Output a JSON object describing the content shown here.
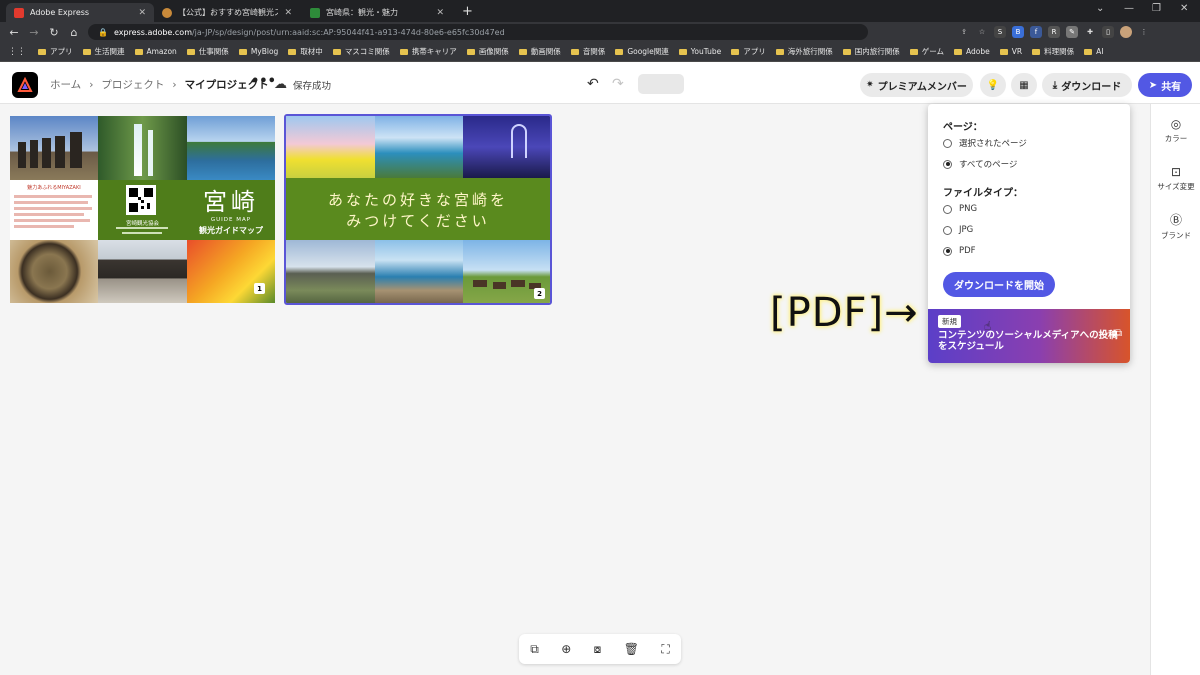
{
  "browser": {
    "tabs": [
      {
        "title": "Adobe Express",
        "active": true
      },
      {
        "title": "【公式】おすすめ宮崎観光スポット／...",
        "active": false
      },
      {
        "title": "宮崎県：観光・魅力",
        "active": false
      }
    ],
    "url_host": "express.adobe.com",
    "url_path": "/ja-JP/sp/design/post/urn:aaid:sc:AP:95044f41-a913-474d-80e6-e65fc30d47ed",
    "bookmarks": [
      "アプリ",
      "生活関連",
      "Amazon",
      "仕事関係",
      "MyBlog",
      "取材中",
      "マスコミ関係",
      "携帯キャリア",
      "画像関係",
      "動画関係",
      "音関係",
      "Google関連",
      "YouTube",
      "アプリ",
      "海外旅行関係",
      "国内旅行関係",
      "ゲーム",
      "Adobe",
      "VR",
      "料理関係",
      "AI"
    ]
  },
  "header": {
    "breadcrumb": [
      "ホーム",
      "プロジェクト",
      "マイプロジェクト"
    ],
    "more": "•••",
    "saved_status": "保存成功",
    "premium_label": "プレミアムメンバー",
    "download_label": "ダウンロード",
    "share_label": "共有"
  },
  "rail": [
    {
      "label": "カラー",
      "icon": "palette-icon"
    },
    {
      "label": "サイズ変更",
      "icon": "resize-icon"
    },
    {
      "label": "ブランド",
      "icon": "brand-icon"
    }
  ],
  "download_panel": {
    "pages_heading": "ページ：",
    "page_options": [
      {
        "label": "選択されたページ",
        "selected": false
      },
      {
        "label": "すべてのページ",
        "selected": true
      }
    ],
    "filetype_heading": "ファイルタイプ：",
    "filetype_options": [
      {
        "label": "PNG",
        "selected": false
      },
      {
        "label": "JPG",
        "selected": false
      },
      {
        "label": "PDF",
        "selected": true
      }
    ],
    "start_button": "ダウンロードを開始",
    "promo_badge": "新規",
    "promo_text": "コンテンツのソーシャルメディアへの投稿をスケジュール"
  },
  "annotation": "[PDF]→",
  "canvas": {
    "page1": {
      "title_kanji": "宮崎",
      "guide_en": "GUIDE MAP",
      "guide_jp": "観光ガイドマップ",
      "qr_caption": "宮崎観光協会",
      "intro_heading": "魅力あふれるMIYAZAKI",
      "page_number": "1"
    },
    "page2": {
      "banner_line1": "あなたの好きな宮崎を",
      "banner_line2": "みつけてください",
      "page_number": "2"
    }
  },
  "colors": {
    "accent": "#5258e4",
    "banner_green": "#5a8a1e",
    "selection": "#5a55d6"
  }
}
